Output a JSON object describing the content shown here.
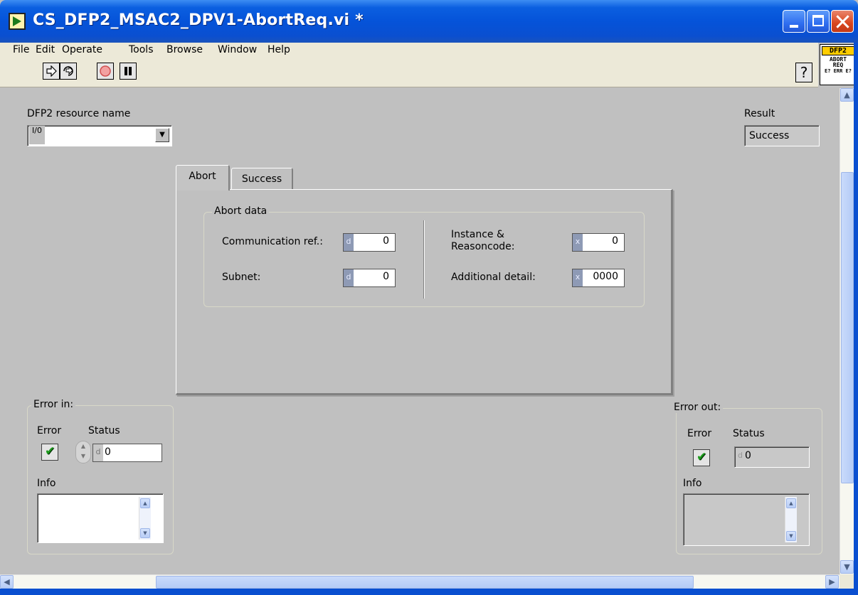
{
  "window": {
    "title": "CS_DFP2_MSAC2_DPV1-AbortReq.vi *"
  },
  "menu": [
    "File",
    "Edit",
    "Operate",
    "Tools",
    "Browse",
    "Window",
    "Help"
  ],
  "toolbar": {
    "run_icon": "run-arrow-icon",
    "run_continuous_icon": "run-continuously-icon",
    "abort_icon": "abort-stop-icon",
    "pause_icon": "pause-icon",
    "help_glyph": "?"
  },
  "vi_icon": {
    "line1": "DFP2",
    "line2": "ABORT",
    "line3": "REQ",
    "line4": "E? ERR E?"
  },
  "resource": {
    "label": "DFP2 resource name",
    "io_glyph": "I/0",
    "value": ""
  },
  "result": {
    "label": "Result",
    "value": "Success"
  },
  "tabs": [
    {
      "label": "Abort",
      "selected": true
    },
    {
      "label": "Success",
      "selected": false
    }
  ],
  "abort_data": {
    "group_label": "Abort data",
    "communication_ref": {
      "label": "Communication ref.:",
      "radix": "d",
      "value": "0"
    },
    "subnet": {
      "label": "Subnet:",
      "radix": "d",
      "value": "0"
    },
    "instance_reasoncode": {
      "label_line1": "Instance &",
      "label_line2": "Reasoncode:",
      "radix": "x",
      "value": "0"
    },
    "additional_detail": {
      "label": "Additional detail:",
      "radix": "x",
      "value": "0000"
    }
  },
  "error_in": {
    "group_label": "Error in:",
    "error_label": "Error",
    "status_label": "Status",
    "status_radix": "d",
    "status_value": "0",
    "info_label": "Info",
    "info_value": ""
  },
  "error_out": {
    "group_label": "Error out:",
    "error_label": "Error",
    "status_label": "Status",
    "status_radix": "d",
    "status_value": "0",
    "info_label": "Info",
    "info_value": ""
  },
  "colors": {
    "titlebar": "#0553d9",
    "panel": "#c0c0c0",
    "check": "#1c9a1c"
  }
}
